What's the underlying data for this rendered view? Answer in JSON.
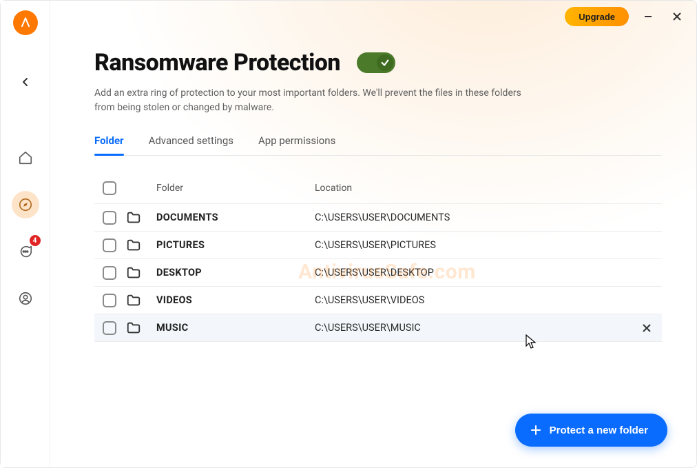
{
  "titlebar": {
    "upgrade_label": "Upgrade"
  },
  "sidebar": {
    "notification_count": "4"
  },
  "page": {
    "title": "Ransomware Protection",
    "subtitle": "Add an extra ring of protection to your most important folders. We'll prevent the files in these folders from being stolen or changed by malware.",
    "toggle_on": true
  },
  "tabs": [
    {
      "label": "Folder",
      "active": true
    },
    {
      "label": "Advanced settings",
      "active": false
    },
    {
      "label": "App permissions",
      "active": false
    }
  ],
  "table": {
    "col_folder": "Folder",
    "col_location": "Location",
    "rows": [
      {
        "name": "DOCUMENTS",
        "location": "C:\\USERS\\USER\\DOCUMENTS",
        "hover": false
      },
      {
        "name": "PICTURES",
        "location": "C:\\USERS\\USER\\PICTURES",
        "hover": false
      },
      {
        "name": "DESKTOP",
        "location": "C:\\USERS\\USER\\DESKTOP",
        "hover": false
      },
      {
        "name": "VIDEOS",
        "location": "C:\\USERS\\USER\\VIDEOS",
        "hover": false
      },
      {
        "name": "MUSIC",
        "location": "C:\\USERS\\USER\\MUSIC",
        "hover": true
      }
    ]
  },
  "cta": {
    "label": "Protect a new folder"
  },
  "watermark": "AntivirusSafe.com"
}
